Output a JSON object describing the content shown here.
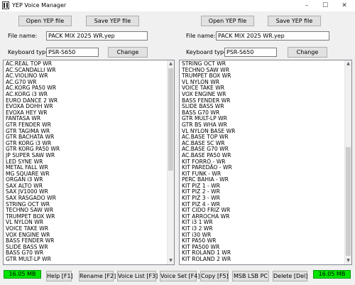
{
  "window": {
    "title": "YEP Voice Manager",
    "minimize": "–",
    "maximize": "☐",
    "close": "✕"
  },
  "left": {
    "open_label": "Open YEP file",
    "save_label": "Save YEP file",
    "file_name_label": "File name:",
    "file_name_value": "PACK MIX 2025 WR.yep",
    "keyboard_label": "Keyboard type:",
    "keyboard_value": "PSR-S650",
    "change_label": "Change",
    "items": [
      "AC.REAL TOP WR",
      "AC.SCANDALLI WR",
      "AC.VIOLINO WR",
      "AC.G70 WR",
      "AC.KORG PA50 WR",
      "AC.KORG i3 WR",
      "EURO DANCE 2 WR",
      "EVOXA DOHH WR",
      "EVOXA HEY WR",
      "FANTASA WR",
      "GTR FENDER WR",
      "GTR TAGIMA WR",
      "GTR BACHATA WR",
      "GTR KORG i3 WR",
      "GTR KORG PA50 WR",
      "JP SUPER SAW WR",
      "LED SYNE WR",
      "METAL FALL WR",
      "MG SQUARE WR",
      "ORGAN i3 WR",
      "SAX ALTO WR",
      "SAX JV1000 WR",
      "SAX RASGADO WR",
      "STRING OCT WR",
      "TECHNO SAW WR",
      "TRUMPET BOX WR",
      "VL NYLON WR",
      "VOICE TAKE WR",
      "VOX ENGINE WR",
      "BASS FENDER WR",
      "SLIDE BASS WR",
      "BASS G70 WR",
      "GTR MULT-LP WR"
    ]
  },
  "right": {
    "open_label": "Open YEP file",
    "save_label": "Save YEP file",
    "file_name_label": "File name:",
    "file_name_value": "PACK MIX 2025 WR.yep",
    "keyboard_label": "Keyboard type:",
    "keyboard_value": "PSR-S650",
    "change_label": "Change",
    "items": [
      "STRING OCT WR",
      "TECHNO SAW WR",
      "TRUMPET BOX WR",
      "VL NYLON WR",
      "VOICE TAKE WR",
      "VOX ENGINE WR",
      "BASS FENDER WR",
      "SLIDE BASS WR",
      "BASS G70 WR",
      "GTR MULT-LP WR",
      "GTR BS WHA WR",
      "VL NYLON BASE WR",
      "AC.BASE TOP WR",
      "AC.BASE SC WR",
      "AC.BASE G70 WR",
      "AC.BASE PA50 WR",
      "KIT FORRÓ - WR",
      "KIT PAREDÃO - WR",
      "KIT FUNK - WR",
      "PERC BAHIA - WR",
      "KIT PIZ 1 - WR",
      "KIT PIZ 2 - WR",
      "KIT PIZ 3 - WR",
      "KIT PIZ 4 - WR",
      "KIT CIDO FRIZ WR",
      "KIT ARROCHA WR",
      "KIT i3 1 WR",
      "KIT i3 2 WR",
      "KIT i30 WR",
      "KIT PA50 WR",
      "KIT PA500 WR",
      "KIT ROLAND 1 WR",
      "KIT ROLAND 2 WR"
    ]
  },
  "bottom": {
    "left_size": "16.05 MB",
    "right_size": "16.05 MB",
    "help": "Help [F1]",
    "rename": "Rename [F2]",
    "voice_list": "Voice List [F3]",
    "voice_set": "Voice Set [F4]",
    "copy": "Copy [F5]",
    "msb_lsb": "MSB LSB PC",
    "delete": "Delete [Del]"
  },
  "colors": {
    "status_green": "#00e400",
    "window_bg": "#f0f0f0"
  }
}
